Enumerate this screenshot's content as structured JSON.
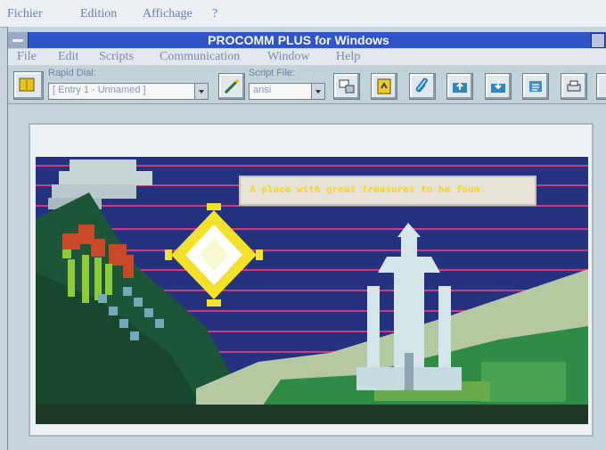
{
  "host_menu": [
    "Fichier",
    "Edition",
    "Affichage",
    "?"
  ],
  "app": {
    "title": "PROCOMM PLUS for Windows",
    "menu": [
      "File",
      "Edit",
      "Scripts",
      "Communication",
      "Window",
      "Help"
    ]
  },
  "toolbar": {
    "rapid_dial_label": "Rapid Dial:",
    "rapid_dial_value": "[ Entry 1 - Unnamed ]",
    "script_file_label": "Script File:",
    "script_file_value": "ansi",
    "icons": [
      "phonebook-icon",
      "wand-icon",
      "connect-icon",
      "script-icon",
      "paperclip-icon",
      "upload-icon",
      "download-icon",
      "keyboard-icon",
      "printer-icon",
      "phone-icon"
    ]
  },
  "terminal": {
    "banner_text": "A place with great treasures to be foun",
    "colors": {
      "sky": "#25327f",
      "stripe": "#d23a80",
      "hills": "#2c8a3e",
      "sun": "#f6e416"
    }
  }
}
